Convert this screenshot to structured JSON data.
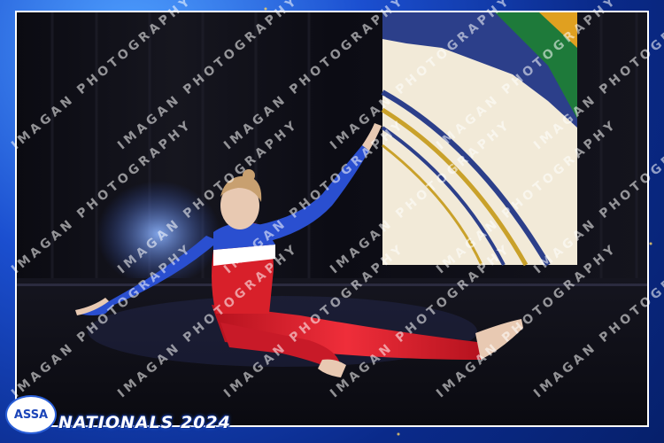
{
  "event": {
    "logo_text": "ASSA",
    "title": "NATIONALS 2024"
  },
  "watermark": {
    "text": "IMAGAN PHOTOGRAPHY"
  },
  "colors": {
    "frame_blue": "#1b4fd0",
    "stage_floor": "#101018",
    "costume_red": "#d8202a",
    "costume_blue": "#2a4fd0"
  }
}
